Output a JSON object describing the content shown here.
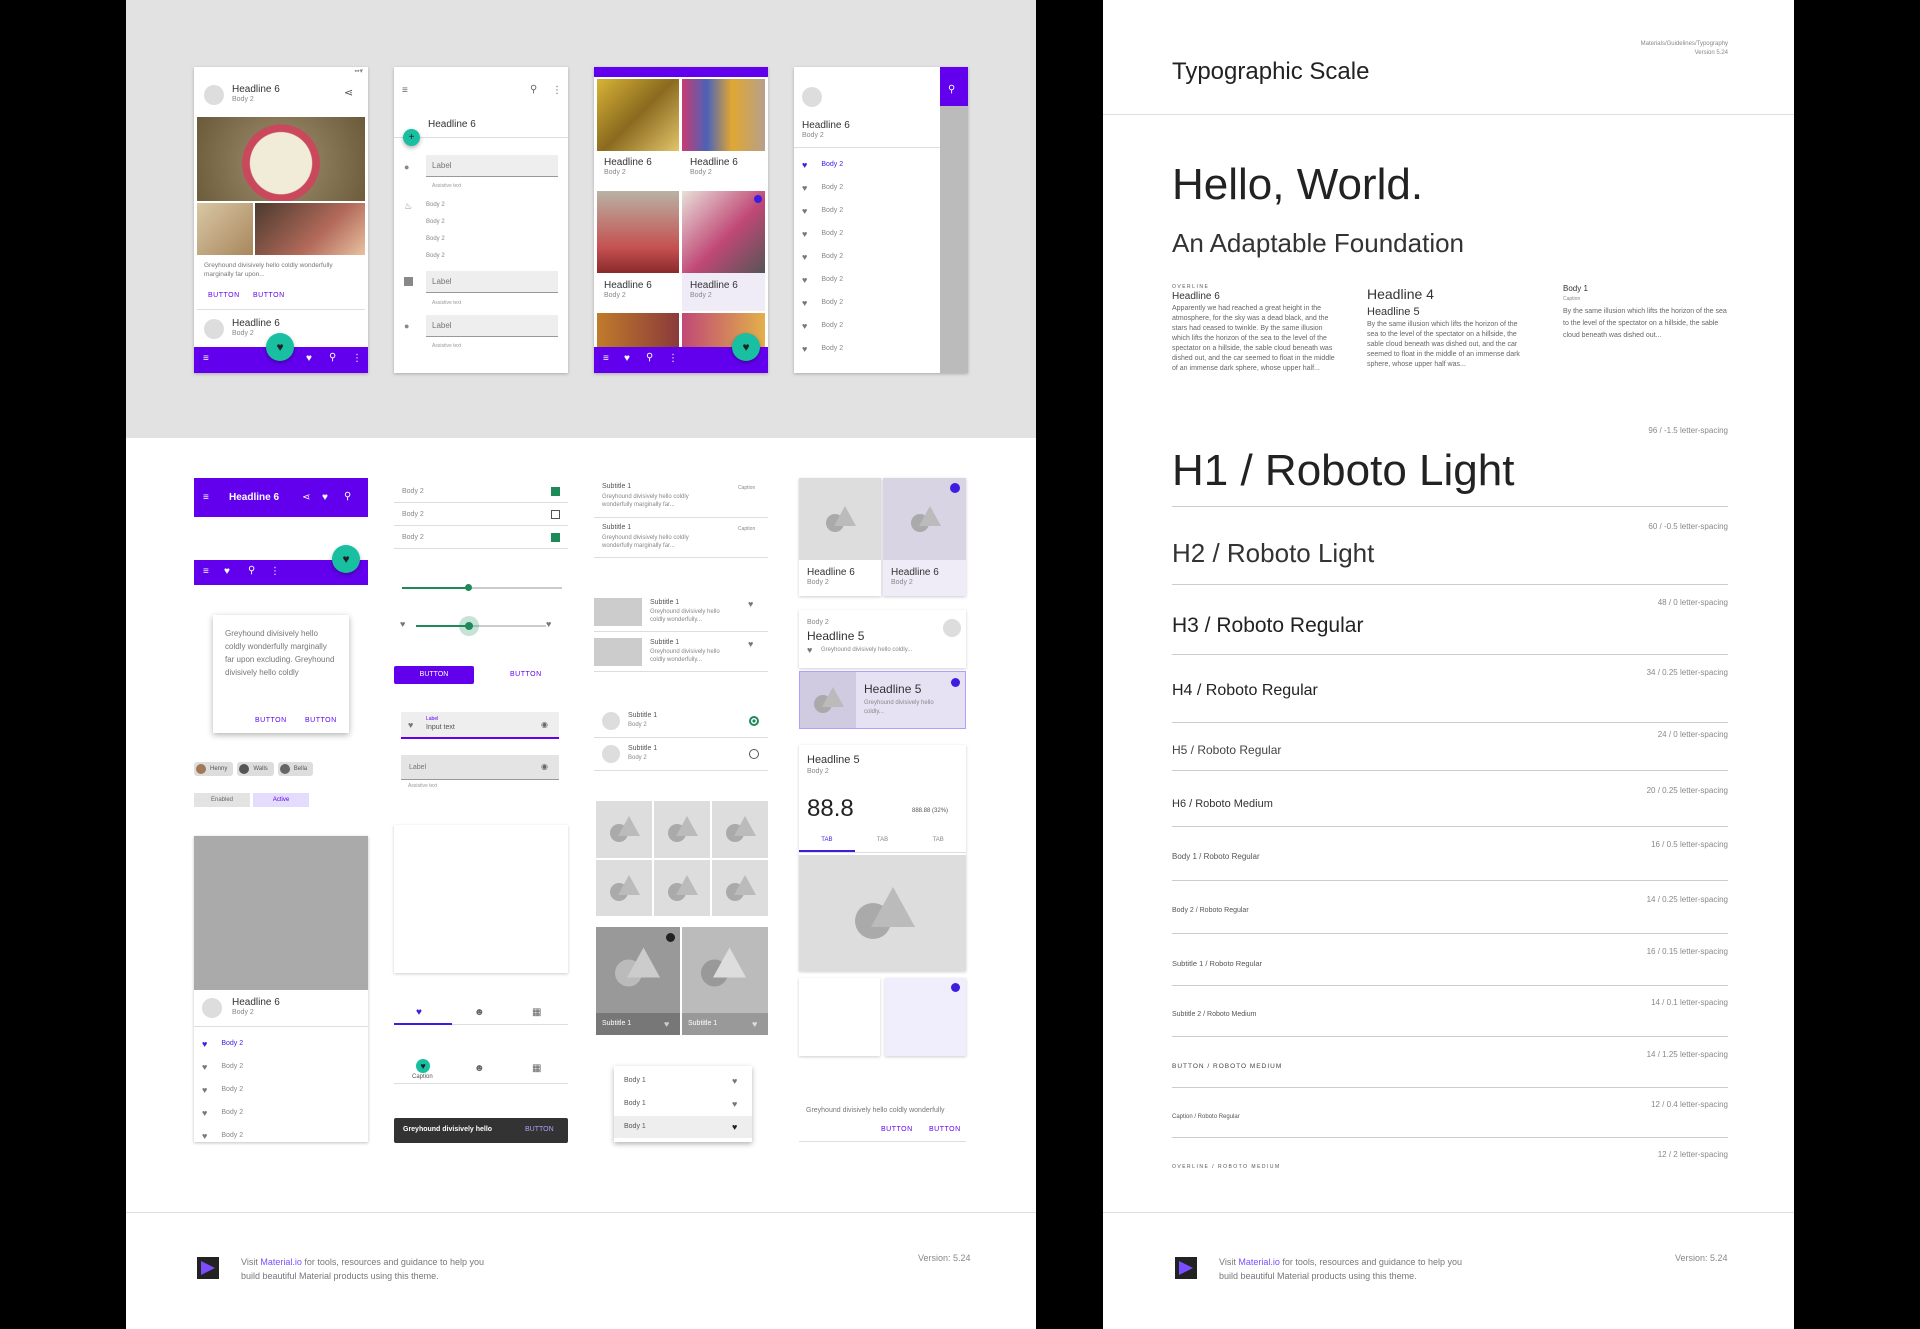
{
  "phones": {
    "p1": {
      "title": "Headline 6",
      "sub": "Body 2",
      "caption": "Greyhound divisively hello coldly wonderfully marginally far upon...",
      "btn1": "BUTTON",
      "btn2": "BUTTON",
      "title2": "Headline 6",
      "sub2": "Body 2"
    },
    "p2": {
      "title": "Headline 6",
      "label": "Label",
      "helper": "Assistive text",
      "items": [
        "Body 2",
        "Body 2",
        "Body 2",
        "Body 2"
      ]
    },
    "p3": {
      "tiles": [
        {
          "t": "Headline 6",
          "s": "Body 2"
        },
        {
          "t": "Headline 6",
          "s": "Body 2"
        },
        {
          "t": "Headline 6",
          "s": "Body 2"
        },
        {
          "t": "Headline 6",
          "s": "Body 2"
        }
      ]
    },
    "p4": {
      "title": "Headline 6",
      "sub": "Body 2",
      "items": [
        "Body 2",
        "Body 2",
        "Body 2",
        "Body 2",
        "Body 2",
        "Body 2",
        "Body 2",
        "Body 2",
        "Body 2"
      ]
    }
  },
  "components": {
    "appbar_title": "Headline 6",
    "dialog_text": "Greyhound divisively hello coldly wonderfully marginally far upon excluding. Greyhound divisively hello coldly",
    "dialog_btn1": "BUTTON",
    "dialog_btn2": "BUTTON",
    "chips": [
      "Henny",
      "Walls",
      "Bella"
    ],
    "chip_enabled": "Enabled",
    "chip_active": "Active",
    "card_title": "Headline 6",
    "card_sub": "Body 2",
    "card_items": [
      "Body 2",
      "Body 2",
      "Body 2",
      "Body 2",
      "Body 2"
    ],
    "checkbox_items": [
      "Body 2",
      "Body 2",
      "Body 2"
    ],
    "contained_btn": "BUTTON",
    "text_btn": "BUTTON",
    "field_label": "Label",
    "field_input": "Input text",
    "field_label2": "Label",
    "field_helper": "Assistive text",
    "bottom_nav_caption": "Caption",
    "snackbar_text": "Greyhound divisively hello",
    "snackbar_btn": "BUTTON",
    "list_items": [
      {
        "t": "Subtitle 1",
        "s": "Greyhound divisively hello coldly wonderfully marginally far...",
        "c": "Caption"
      },
      {
        "t": "Subtitle 1",
        "s": "Greyhound divisively hello coldly wonderfully marginally far...",
        "c": "Caption"
      }
    ],
    "thumb_items": [
      {
        "t": "Subtitle 1",
        "s": "Greyhound divisively hello coldly wonderfully..."
      },
      {
        "t": "Subtitle 1",
        "s": "Greyhound divisively hello coldly wonderfully..."
      }
    ],
    "radio_items": [
      {
        "t": "Subtitle 1",
        "s": "Body 2"
      },
      {
        "t": "Subtitle 1",
        "s": "Body 2"
      }
    ],
    "image_list_captions": [
      "Subtitle 1",
      "Subtitle 1"
    ],
    "menu_items": [
      "Body 1",
      "Body 1",
      "Body 1"
    ],
    "grid_cards": [
      {
        "t": "Headline 6",
        "s": "Body 2"
      },
      {
        "t": "Headline 6",
        "s": "Body 2"
      }
    ],
    "h5_card": {
      "over": "Body 2",
      "t": "Headline 5",
      "s": "Greyhound divisively hello coldly..."
    },
    "h5_card2": {
      "t": "Headline 5",
      "s": "Greyhound divisively hello coldly..."
    },
    "stat_card": {
      "t": "Headline 5",
      "s": "Body 2",
      "value": "88.8",
      "delta": "888.88 (32%)",
      "tabs": [
        "TAB",
        "TAB",
        "TAB"
      ]
    },
    "banner_text": "Greyhound divisively hello coldly wonderfully",
    "banner_btn1": "BUTTON",
    "banner_btn2": "BUTTON"
  },
  "typography": {
    "title": "Typographic Scale",
    "meta_path": "Materials/Guidelines/Typography",
    "meta_version": "Version 5.24",
    "hello": "Hello, World.",
    "foundation": "An Adaptable Foundation",
    "col1_over": "OVERLINE",
    "col1_head": "Headline 6",
    "col1_body": "Apparently we had reached a great height in the atmosphere, for the sky was a dead black, and the stars had ceased to twinkle. By the same illusion which lifts the horizon of the sea to the level of the spectator on a hillside, the sable cloud beneath was dished out, and the car seemed to float in the middle of an immense dark sphere, whose upper half...",
    "col2_head": "Headline 4",
    "col2_sub": "Headline 5",
    "col2_body": "By the same illusion which lifts the horizon of the sea to the level of the spectator on a hillside, the sable cloud beneath was dished out, and the car seemed to float in the middle of an immense dark sphere, whose upper half was...",
    "col3_head": "Body 1",
    "col3_cap": "Caption",
    "col3_body": "By the same illusion which lifts the horizon of the sea to the level of the spectator on a hillside, the sable cloud beneath was dished out...",
    "scale": [
      {
        "label": "H1 / Roboto Light",
        "meta": "96 / -1.5 letter-spacing"
      },
      {
        "label": "H2 / Roboto Light",
        "meta": "60 / -0.5 letter-spacing"
      },
      {
        "label": "H3 / Roboto Regular",
        "meta": "48 / 0 letter-spacing"
      },
      {
        "label": "H4 / Roboto Regular",
        "meta": "34 / 0.25 letter-spacing"
      },
      {
        "label": "H5 / Roboto Regular",
        "meta": "24 / 0 letter-spacing"
      },
      {
        "label": "H6 / Roboto Medium",
        "meta": "20 / 0.25 letter-spacing"
      },
      {
        "label": "Body 1 / Roboto Regular",
        "meta": "16 / 0.5 letter-spacing"
      },
      {
        "label": "Body 2 / Roboto Regular",
        "meta": "14 / 0.25 letter-spacing"
      },
      {
        "label": "Subtitle 1 / Roboto Regular",
        "meta": "16 / 0.15 letter-spacing"
      },
      {
        "label": "Subtitle 2 / Roboto Medium",
        "meta": "14 / 0.1 letter-spacing"
      },
      {
        "label": "BUTTON / ROBOTO MEDIUM",
        "meta": "14 / 1.25 letter-spacing"
      },
      {
        "label": "Caption / Roboto Regular",
        "meta": "12 / 0.4 letter-spacing"
      },
      {
        "label": "OVERLINE / ROBOTO MEDIUM",
        "meta": "12 / 2 letter-spacing"
      }
    ]
  },
  "footer": {
    "pre": "Visit ",
    "link": "Material.io",
    "post": " for tools, resources and guidance to help you build beautiful Material products using this theme.",
    "version": "Version: 5.24"
  },
  "colors": {
    "primary": "#6200ee",
    "secondary": "#18bfa0"
  }
}
